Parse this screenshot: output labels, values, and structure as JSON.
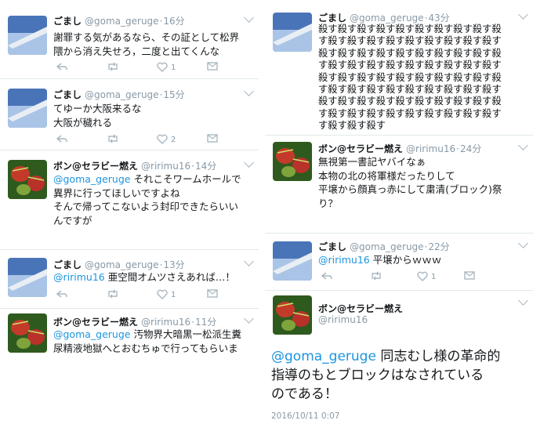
{
  "colors": {
    "mention": "#1b95e0",
    "meta": "#8899a6",
    "icon": "#aab8c2"
  },
  "left": {
    "tweets": [
      {
        "name": "ごまし",
        "handle": "@goma_geruge",
        "time": "16分",
        "avatar": "airplane-wing",
        "lines": [
          "謝罪する気があるなら、その証として松界",
          "隈から消え失せろ，二度と出てくんな"
        ],
        "likes": "1"
      },
      {
        "name": "ごまし",
        "handle": "@goma_geruge",
        "time": "15分",
        "avatar": "airplane-wing",
        "lines": [
          "てゆーか大阪来るな",
          "大阪が穢れる"
        ],
        "likes": "2"
      },
      {
        "name": "ボン@セラビー燃え",
        "handle": "@ririmu16",
        "time": "14分",
        "avatar": "venus-flytrap",
        "mention": "@goma_geruge",
        "first": " それこそワームホールで",
        "lines": [
          "異界に行ってほしいですよね",
          "そんで帰ってこないよう封印できたらいい",
          "んですが"
        ],
        "likes": ""
      },
      {
        "name": "ごまし",
        "handle": "@goma_geruge",
        "time": "13分",
        "avatar": "airplane-wing",
        "mention": "@ririmu16",
        "first": " 亜空間オムツさえあれば…！",
        "likes": "1"
      },
      {
        "name": "ボン@セラビー燃え",
        "handle": "@ririmu16",
        "time": "11分",
        "avatar": "venus-flytrap",
        "mention": "@goma_geruge",
        "first": " 汚物界大暗黒一松派生糞",
        "lines": [
          "尿精液地獄へとおむちゅで行ってもらいま"
        ]
      }
    ]
  },
  "right": {
    "spam": {
      "name": "ごまし",
      "handle": "@goma_geruge",
      "time": "43分",
      "avatar": "airplane-wing",
      "lines": [
        "殺す殺す殺す殺す殺す殺す殺す殺す殺す殺",
        "す殺す殺す殺す殺す殺す殺す殺す殺す殺す",
        "殺す殺す殺す殺す殺す殺す殺す殺す殺す殺",
        "す殺す殺す殺す殺す殺す殺す殺す殺す殺す",
        "殺す殺す殺す殺す殺す殺す殺す殺す殺す殺",
        "す殺す殺す殺す殺す殺す殺す殺す殺す殺す",
        "殺す殺す殺す殺す殺す殺す殺す殺す殺す殺",
        "す殺す殺す殺す殺す殺す殺す殺す殺す殺す",
        "す殺す殺す殺す"
      ]
    },
    "reply1": {
      "name": "ボン@セラビー燃え",
      "handle": "@ririmu16",
      "time": "24分",
      "avatar": "venus-flytrap",
      "lines": [
        "無視第一書記ヤバイなぁ",
        "本物の北の将軍様だったりして",
        "平壌から顔真っ赤にして粛清(ブロック)祭",
        "り？"
      ]
    },
    "reply2": {
      "name": "ごまし",
      "handle": "@goma_geruge",
      "time": "22分",
      "avatar": "airplane-wing",
      "mention": "@ririmu16",
      "first": " 平壌からｗｗｗ",
      "likes": "1"
    },
    "detail": {
      "name": "ボン@セラビー燃え",
      "handle": "@ririmu16",
      "avatar": "venus-flytrap",
      "mention": "@goma_geruge",
      "first": " 同志むし様の革命的",
      "lines": [
        "指導のもとブロックはなされている",
        "のである！"
      ],
      "date": "2016/10/11 0:07"
    }
  }
}
